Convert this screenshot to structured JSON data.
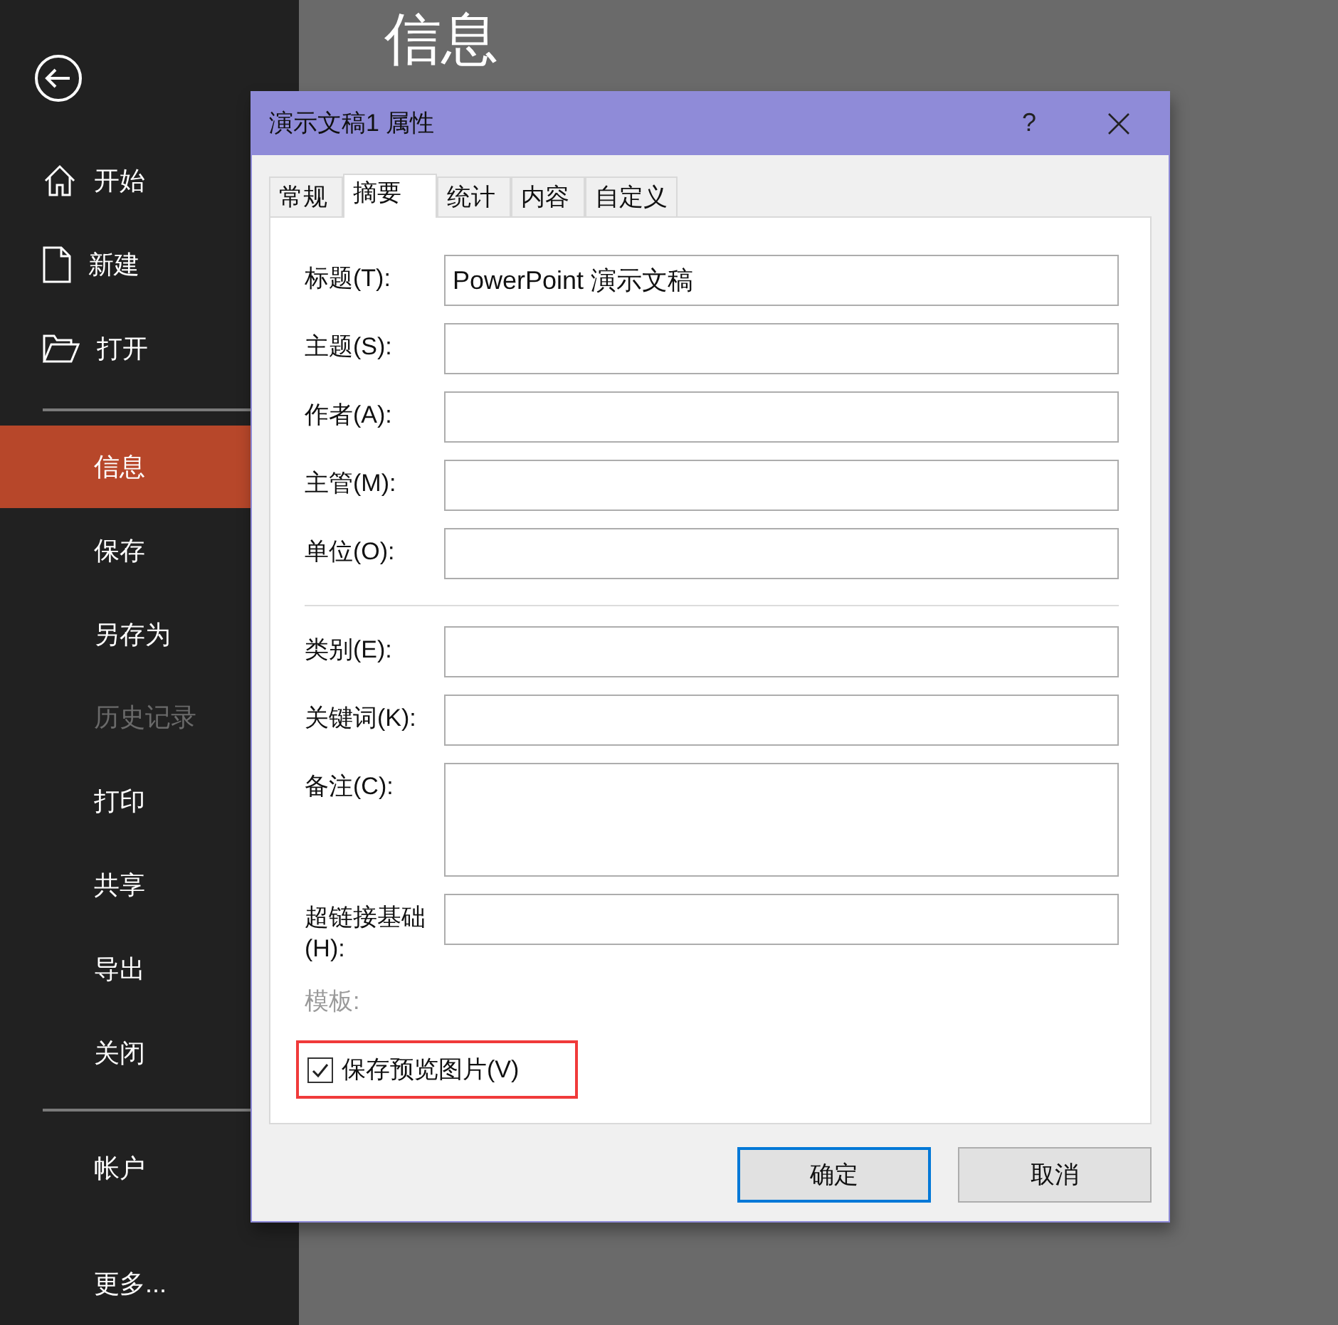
{
  "sidebar": {
    "top_items": [
      {
        "label": "开始",
        "selected": false,
        "disabled": false
      },
      {
        "label": "新建",
        "selected": false,
        "disabled": false
      },
      {
        "label": "打开",
        "selected": false,
        "disabled": false
      }
    ],
    "items": [
      {
        "label": "信息",
        "selected": true,
        "disabled": false
      },
      {
        "label": "保存",
        "selected": false,
        "disabled": false
      },
      {
        "label": "另存为",
        "selected": false,
        "disabled": false
      },
      {
        "label": "历史记录",
        "selected": false,
        "disabled": true
      },
      {
        "label": "打印",
        "selected": false,
        "disabled": false
      },
      {
        "label": "共享",
        "selected": false,
        "disabled": false
      },
      {
        "label": "导出",
        "selected": false,
        "disabled": false
      },
      {
        "label": "关闭",
        "selected": false,
        "disabled": false
      }
    ],
    "bottom_items": [
      {
        "label": "帐户",
        "selected": false,
        "disabled": false
      },
      {
        "label": "更多...",
        "selected": false,
        "disabled": false
      }
    ]
  },
  "page_title": "信息",
  "dialog": {
    "title": "演示文稿1 属性",
    "help": "?",
    "tabs": [
      {
        "label": "常规",
        "selected": false
      },
      {
        "label": "摘要",
        "selected": true
      },
      {
        "label": "统计",
        "selected": false
      },
      {
        "label": "内容",
        "selected": false
      },
      {
        "label": "自定义",
        "selected": false
      }
    ],
    "field_groups": [
      [
        {
          "label": "标题(T):",
          "kind": "text",
          "value": "PowerPoint 演示文稿"
        },
        {
          "label": "主题(S):",
          "kind": "text"
        },
        {
          "label": "作者(A):",
          "kind": "text"
        },
        {
          "label": "主管(M):",
          "kind": "text"
        },
        {
          "label": "单位(O):",
          "kind": "text"
        }
      ],
      [
        {
          "label": "类别(E):",
          "kind": "text"
        },
        {
          "label": "关键词(K):",
          "kind": "text"
        },
        {
          "label": "备注(C):",
          "kind": "multiline"
        },
        {
          "label": "超链接基础(H):",
          "kind": "text"
        }
      ]
    ],
    "template_label": "模板:",
    "checkbox": {
      "label": "保存预览图片(V)",
      "checked": true,
      "highlighted": true
    },
    "buttons": [
      {
        "label": "确定",
        "default": true
      },
      {
        "label": "取消",
        "default": false
      }
    ]
  }
}
